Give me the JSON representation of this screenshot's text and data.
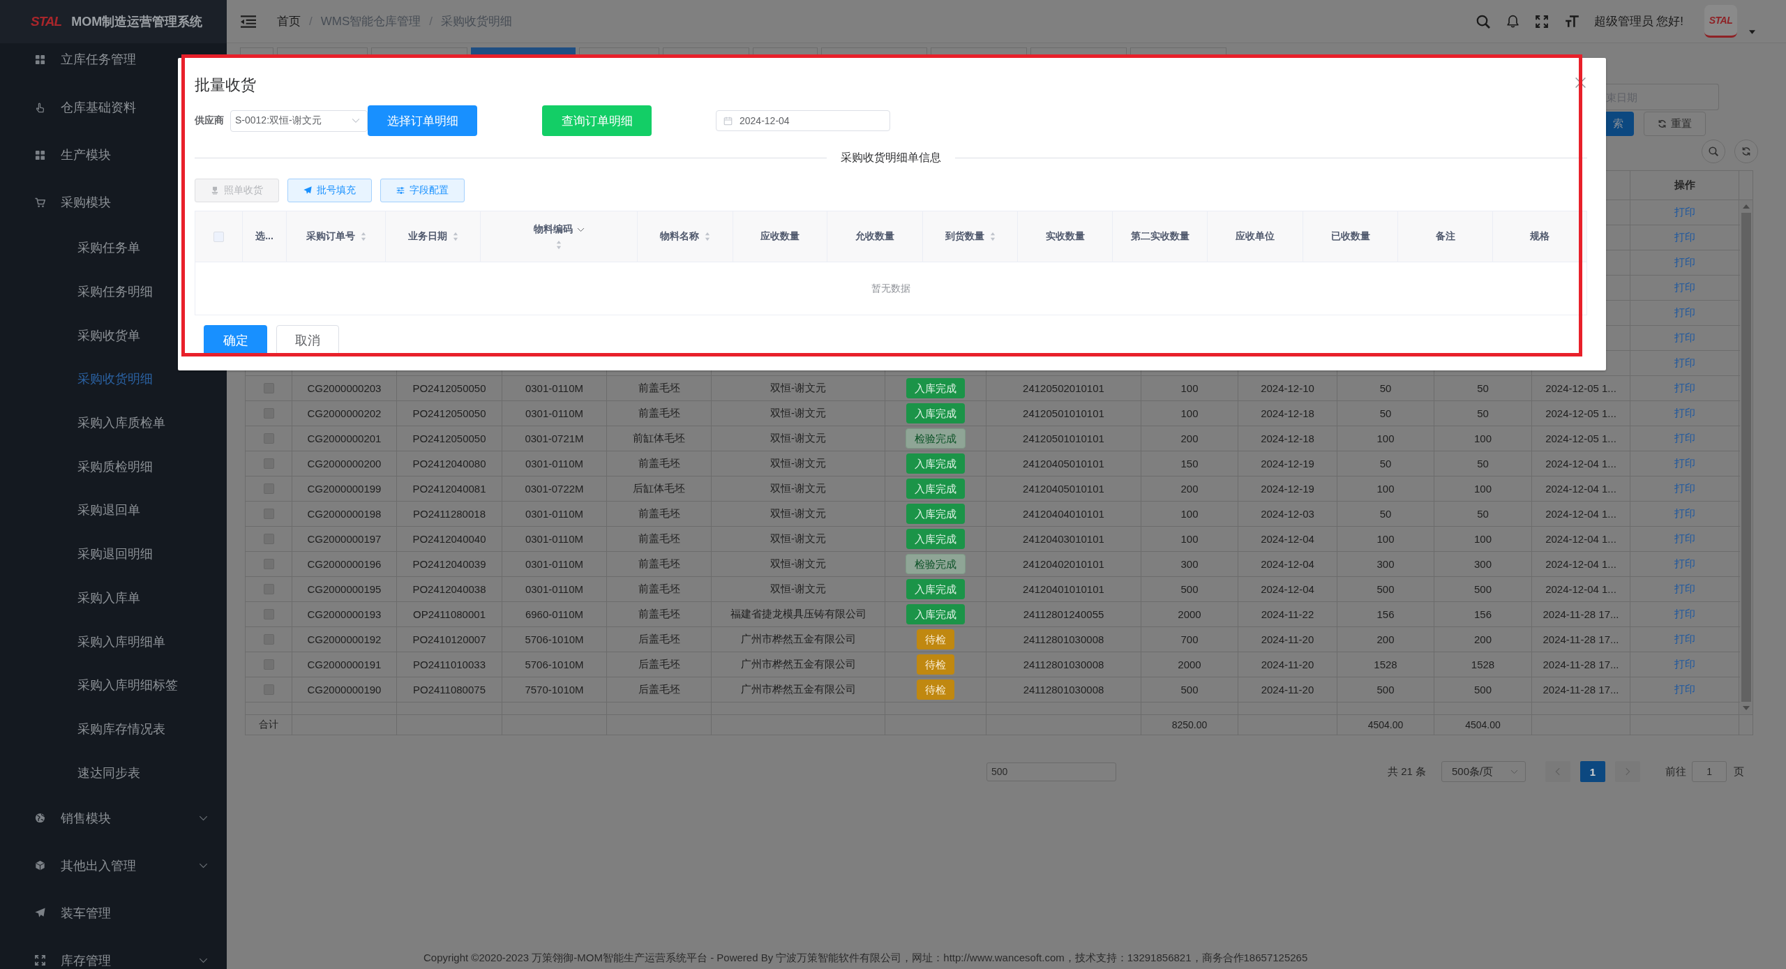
{
  "sidebar": {
    "logo": "STAL",
    "title": "MOM制造运营管理系统",
    "items": [
      {
        "label": "立库任务管理",
        "kind": "link"
      },
      {
        "label": "仓库基础资料",
        "kind": "link"
      },
      {
        "label": "生产模块",
        "kind": "link"
      },
      {
        "label": "采购模块",
        "kind": "submenu",
        "expanded": true,
        "children": [
          {
            "label": "采购任务单",
            "selected": false
          },
          {
            "label": "采购任务明细",
            "selected": false
          },
          {
            "label": "采购收货单",
            "selected": false
          },
          {
            "label": "采购收货明细",
            "selected": true
          },
          {
            "label": "采购入库质检单",
            "selected": false
          },
          {
            "label": "采购质检明细",
            "selected": false
          },
          {
            "label": "采购退回单",
            "selected": false
          },
          {
            "label": "采购退回明细",
            "selected": false
          },
          {
            "label": "采购入库单",
            "selected": false
          },
          {
            "label": "采购入库明细单",
            "selected": false
          },
          {
            "label": "采购入库明细标签",
            "selected": false
          },
          {
            "label": "采购库存情况表",
            "selected": false
          },
          {
            "label": "速达同步表",
            "selected": false
          }
        ]
      },
      {
        "label": "销售模块",
        "kind": "submenu",
        "expanded": false
      },
      {
        "label": "其他出入管理",
        "kind": "submenu",
        "expanded": false
      },
      {
        "label": "装车管理",
        "kind": "link"
      },
      {
        "label": "库存管理",
        "kind": "submenu",
        "expanded": false
      }
    ]
  },
  "header": {
    "breadcrumb": [
      {
        "label": "首页",
        "link": true
      },
      {
        "separator": "/",
        "label": "WMS智能仓库管理",
        "link": false
      },
      {
        "separator": "/",
        "label": "采购收货明细",
        "link": false
      }
    ],
    "greeting": "超级管理员 您好!",
    "avatar": "STAL"
  },
  "tabs": [
    {
      "selected": false
    },
    {
      "selected": false
    },
    {
      "selected": false
    },
    {
      "selected": true
    },
    {
      "selected": false
    },
    {
      "selected": false
    },
    {
      "selected": false
    },
    {
      "selected": false
    },
    {
      "selected": false
    },
    {
      "selected": false
    },
    {
      "selected": false
    }
  ],
  "search": {
    "end_date": {
      "placeholder": "束日期"
    },
    "search_button": "索",
    "reset_button": "重置"
  },
  "table": {
    "action_header": "操作",
    "rows": [
      {
        "action": "打印"
      },
      {
        "action": "打印"
      },
      {
        "action": "打印"
      },
      {
        "action": "打印"
      },
      {
        "action": "打印"
      },
      {
        "action": "打印"
      },
      {
        "action": "打印"
      },
      {
        "checked": false,
        "cells": [
          "CG2000000203",
          "PO2412050050",
          "0301-0110M",
          "前盖毛坯",
          "双恒-谢文元",
          {
            "label": "入库完成",
            "kind": "stored"
          },
          "24120502010101",
          "100",
          "2024-12-10",
          "50",
          "50",
          "2024-12-05 1..."
        ],
        "action": "打印"
      },
      {
        "checked": false,
        "cells": [
          "CG2000000202",
          "PO2412050050",
          "0301-0110M",
          "前盖毛坯",
          "双恒-谢文元",
          {
            "label": "入库完成",
            "kind": "stored"
          },
          "24120501010101",
          "100",
          "2024-12-18",
          "50",
          "50",
          "2024-12-05 1..."
        ],
        "action": "打印"
      },
      {
        "checked": false,
        "cells": [
          "CG2000000201",
          "PO2412050050",
          "0301-0721M",
          "前缸体毛坯",
          "双恒-谢文元",
          {
            "label": "检验完成",
            "kind": "inspected"
          },
          "24120501010101",
          "200",
          "2024-12-18",
          "100",
          "100",
          "2024-12-05 1..."
        ],
        "action": "打印"
      },
      {
        "checked": false,
        "cells": [
          "CG2000000200",
          "PO2412040080",
          "0301-0110M",
          "前盖毛坯",
          "双恒-谢文元",
          {
            "label": "入库完成",
            "kind": "stored"
          },
          "24120405010101",
          "150",
          "2024-12-19",
          "50",
          "50",
          "2024-12-04 1..."
        ],
        "action": "打印"
      },
      {
        "checked": false,
        "cells": [
          "CG2000000199",
          "PO2412040081",
          "0301-0722M",
          "后缸体毛坯",
          "双恒-谢文元",
          {
            "label": "入库完成",
            "kind": "stored"
          },
          "24120405010101",
          "200",
          "2024-12-19",
          "100",
          "100",
          "2024-12-04 1..."
        ],
        "action": "打印"
      },
      {
        "checked": false,
        "cells": [
          "CG2000000198",
          "PO2411280018",
          "0301-0110M",
          "前盖毛坯",
          "双恒-谢文元",
          {
            "label": "入库完成",
            "kind": "stored"
          },
          "24120404010101",
          "100",
          "2024-12-03",
          "50",
          "50",
          "2024-12-04 1..."
        ],
        "action": "打印"
      },
      {
        "checked": false,
        "cells": [
          "CG2000000197",
          "PO2412040040",
          "0301-0110M",
          "前盖毛坯",
          "双恒-谢文元",
          {
            "label": "入库完成",
            "kind": "stored"
          },
          "24120403010101",
          "100",
          "2024-12-04",
          "100",
          "100",
          "2024-12-04 1..."
        ],
        "action": "打印"
      },
      {
        "checked": false,
        "cells": [
          "CG2000000196",
          "PO2412040039",
          "0301-0110M",
          "前盖毛坯",
          "双恒-谢文元",
          {
            "label": "检验完成",
            "kind": "inspected"
          },
          "24120402010101",
          "300",
          "2024-12-04",
          "300",
          "300",
          "2024-12-04 1..."
        ],
        "action": "打印"
      },
      {
        "checked": false,
        "cells": [
          "CG2000000195",
          "PO2412040038",
          "0301-0110M",
          "前盖毛坯",
          "双恒-谢文元",
          {
            "label": "入库完成",
            "kind": "stored"
          },
          "24120401010101",
          "500",
          "2024-12-04",
          "500",
          "500",
          "2024-12-04 1..."
        ],
        "action": "打印"
      },
      {
        "checked": false,
        "cells": [
          "CG2000000193",
          "OP2411080001",
          "6960-0110M",
          "前盖毛坯",
          "福建省捷龙模具压铸有限公司",
          {
            "label": "入库完成",
            "kind": "stored"
          },
          "24112801240055",
          "2000",
          "2024-11-22",
          "156",
          "156",
          "2024-11-28 17..."
        ],
        "action": "打印"
      },
      {
        "checked": false,
        "cells": [
          "CG2000000192",
          "PO2410120007",
          "5706-1010M",
          "后盖毛坯",
          "广州市桦然五金有限公司",
          {
            "label": "待检",
            "kind": "pending"
          },
          "24112801030008",
          "700",
          "2024-11-20",
          "200",
          "200",
          "2024-11-28 17..."
        ],
        "action": "打印"
      },
      {
        "checked": false,
        "cells": [
          "CG2000000191",
          "PO2411010033",
          "5706-1010M",
          "后盖毛坯",
          "广州市桦然五金有限公司",
          {
            "label": "待检",
            "kind": "pending"
          },
          "24112801030008",
          "2000",
          "2024-11-20",
          "1528",
          "1528",
          "2024-11-28 17..."
        ],
        "action": "打印"
      },
      {
        "checked": false,
        "cells": [
          "CG2000000190",
          "PO2411080075",
          "7570-1010M",
          "后盖毛坯",
          "广州市桦然五金有限公司",
          {
            "label": "待检",
            "kind": "pending"
          },
          "24112801030008",
          "500",
          "2024-11-20",
          "500",
          "500",
          "2024-11-28 17..."
        ],
        "action": "打印"
      }
    ],
    "footer": {
      "label": "合计",
      "quantity_total": "8250.00",
      "received_total": "4504.00",
      "received_total_2": "4504.00"
    }
  },
  "pagination": {
    "field": {
      "value": "500"
    },
    "total": "共 21 条",
    "page_size": "500条/页",
    "prev": {
      "disabled": true
    },
    "pages": [
      {
        "label": "1",
        "selected": true
      }
    ],
    "next": {
      "disabled": true
    },
    "goto_label": "前往",
    "goto_value": "1",
    "goto_suffix": "页"
  },
  "copyright": "Copyright ©2020-2023 万策翎御-MOM智能生产运营系统平台 - Powered By 宁波万策智能软件有限公司，网址：http://www.wancesoft.com，技术支持：13291856821，商务合作18657125265",
  "dialog": {
    "title": "批量收货",
    "supplier": {
      "label": "供应商",
      "value": "S-0012:双恒-谢文元"
    },
    "select_button": "选择订单明细",
    "query_button": "查询订单明细",
    "date": {
      "value": "2024-12-04"
    },
    "section_title": "采购收货明细单信息",
    "toolbar": [
      {
        "label": "照单收货",
        "disabled": true
      },
      {
        "label": "批号填充",
        "disabled": false
      },
      {
        "label": "字段配置",
        "disabled": false
      }
    ],
    "select_all": {
      "checked": false,
      "disabled": true
    },
    "columns": [
      {
        "label": "选...",
        "sortable": false,
        "filterable": false
      },
      {
        "label": "采购订单号",
        "sortable": true,
        "filterable": false
      },
      {
        "label": "业务日期",
        "sortable": true,
        "filterable": false
      },
      {
        "label": "物料编码",
        "sortable": true,
        "filterable": true
      },
      {
        "label": "物料名称",
        "sortable": true,
        "filterable": false
      },
      {
        "label": "应收数量",
        "sortable": false,
        "filterable": false
      },
      {
        "label": "允收数量",
        "sortable": false,
        "filterable": false
      },
      {
        "label": "到货数量",
        "sortable": true,
        "filterable": false
      },
      {
        "label": "实收数量",
        "sortable": false,
        "filterable": false
      },
      {
        "label": "第二实收数量",
        "sortable": false,
        "filterable": false
      },
      {
        "label": "应收单位",
        "sortable": false,
        "filterable": false
      },
      {
        "label": "已收数量",
        "sortable": false,
        "filterable": false
      },
      {
        "label": "备注",
        "sortable": false,
        "filterable": false
      },
      {
        "label": "规格",
        "sortable": false,
        "filterable": false
      }
    ],
    "empty_text": "暂无数据",
    "confirm_button": "确定",
    "cancel_button": "取消"
  },
  "annotation": {
    "kind": "rectangle"
  }
}
